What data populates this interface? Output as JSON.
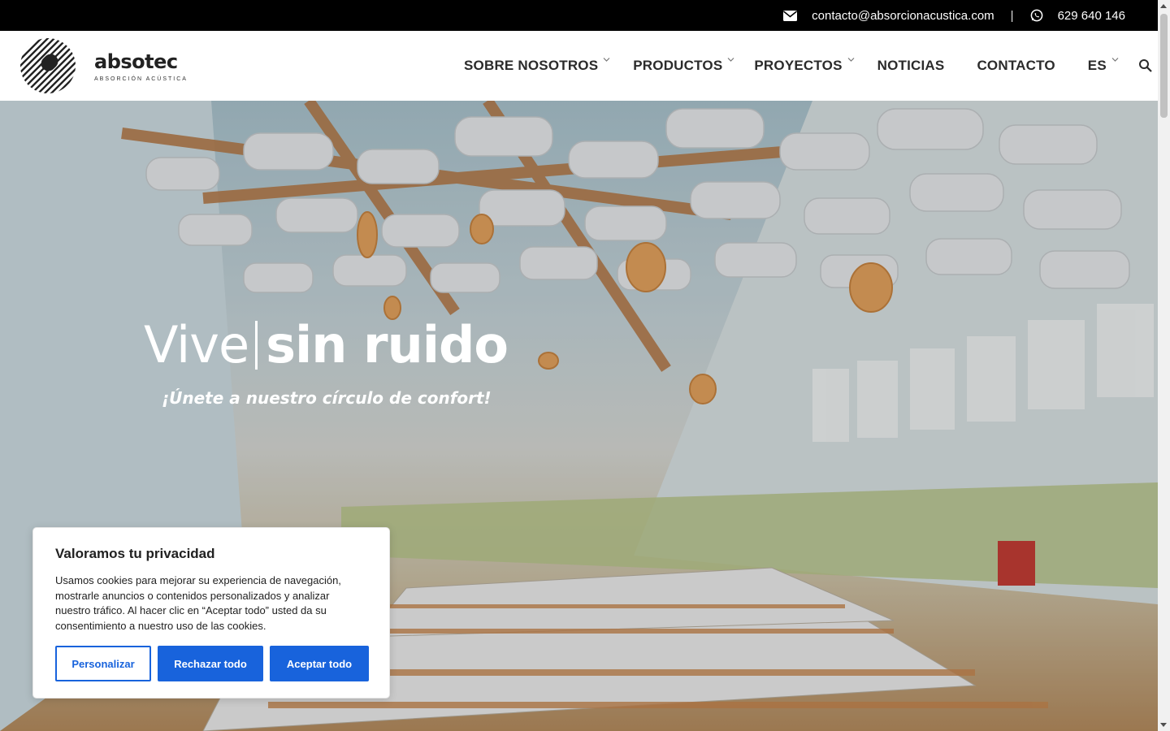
{
  "topbar": {
    "email_icon": "envelope-icon",
    "email": "contacto@absorcionacustica.com",
    "separator": "|",
    "phone_icon": "whatsapp-icon",
    "phone": "629 640 146"
  },
  "logo": {
    "name": "absotec",
    "tagline": "ABSORCIÓN ACÚSTICA",
    "mark_icon": "striped-circle-logo-icon"
  },
  "nav": {
    "items": [
      {
        "label": "SOBRE NOSOTROS",
        "has_dropdown": true
      },
      {
        "label": "PRODUCTOS",
        "has_dropdown": true
      },
      {
        "label": "PROYECTOS",
        "has_dropdown": true
      },
      {
        "label": "NOTICIAS",
        "has_dropdown": false
      },
      {
        "label": "CONTACTO",
        "has_dropdown": false
      },
      {
        "label": "ES",
        "has_dropdown": true
      }
    ],
    "search_icon": "search-icon"
  },
  "hero": {
    "title_light": "Vive",
    "title_bold": "sin ruido",
    "subtitle": "¡Únete a nuestro círculo de confort!"
  },
  "cookie": {
    "title": "Valoramos tu privacidad",
    "text": "Usamos cookies para mejorar su experiencia de navegación, mostrarle anuncios o contenidos personalizados y analizar nuestro tráfico. Al hacer clic en “Aceptar todo” usted da su consentimiento a nuestro uso de las cookies.",
    "customize_label": "Personalizar",
    "reject_label": "Rechazar todo",
    "accept_label": "Aceptar todo"
  },
  "colors": {
    "topbar_bg": "#000000",
    "button_blue": "#1863dc",
    "nav_text": "#2b2b2b"
  }
}
